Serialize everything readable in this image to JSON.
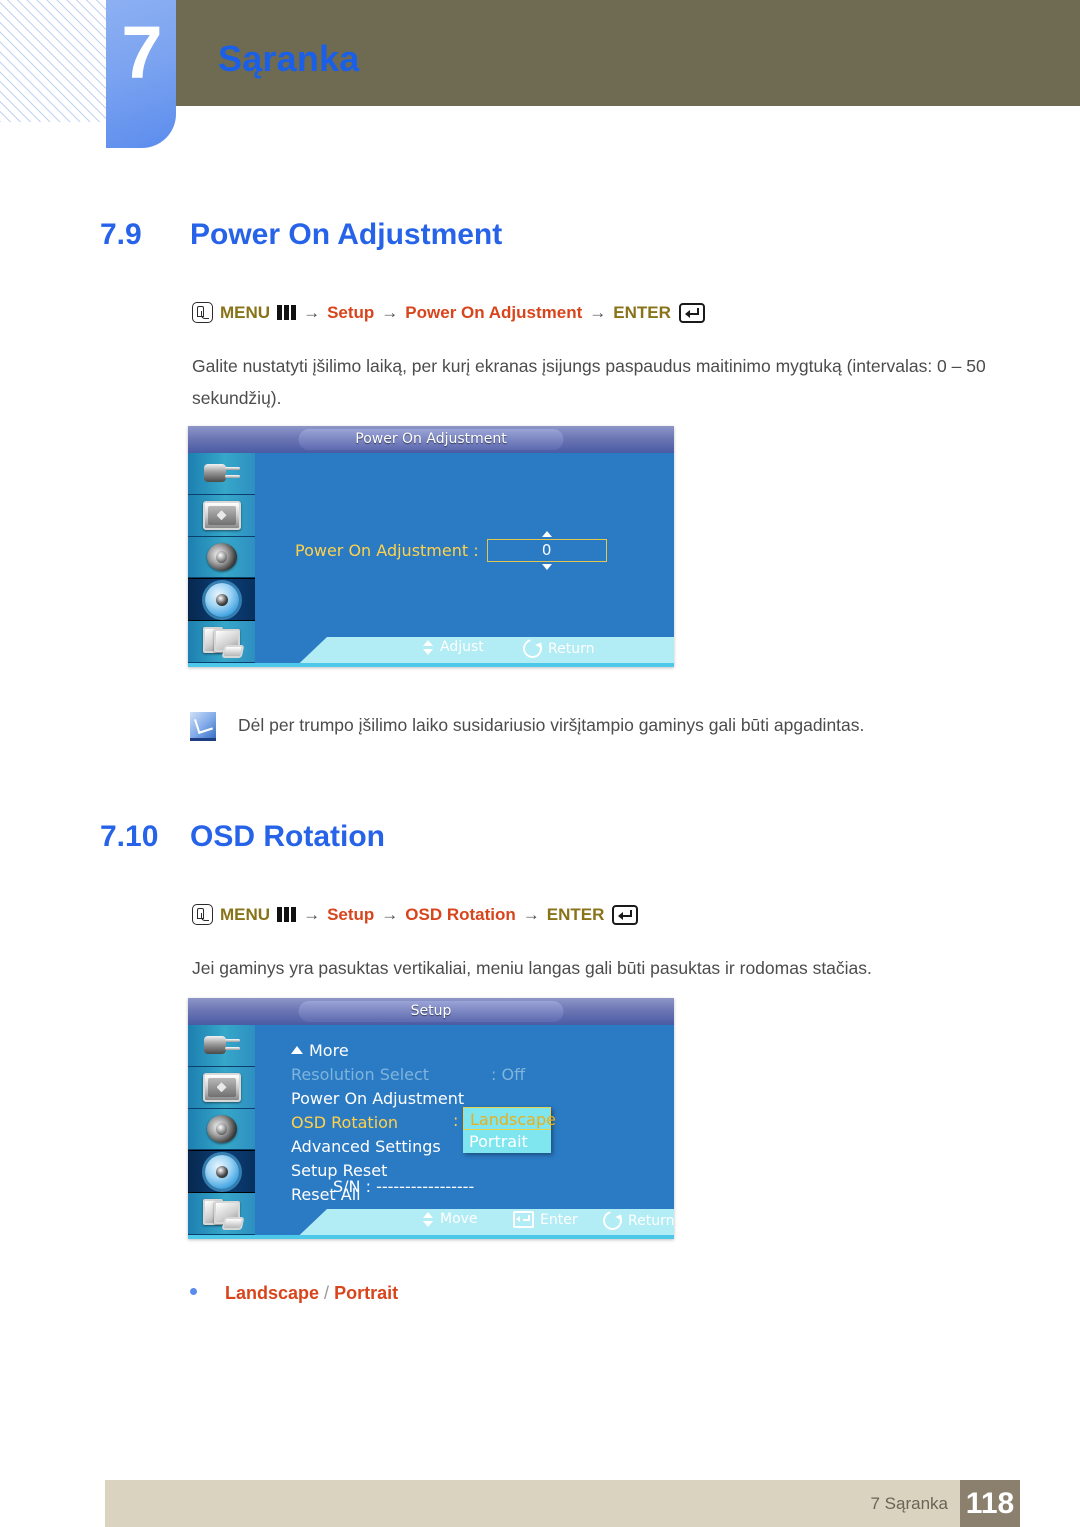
{
  "header": {
    "chapter_number": "7",
    "chapter_title": "Sąranka"
  },
  "sections": [
    {
      "number": "7.9",
      "title": "Power On Adjustment",
      "nav": {
        "menu_label": "MENU",
        "arrow": "→",
        "step1": "Setup",
        "step2": "Power On Adjustment",
        "enter_label": "ENTER"
      },
      "paragraph": "Galite nustatyti įšilimo laiką, per kurį ekranas įsijungs paspaudus maitinimo mygtuką (intervalas: 0 – 50 sekundžių).",
      "note": "Dėl per trumpo įšilimo laiko susidariusio viršįtampio gaminys gali būti apgadintas."
    },
    {
      "number": "7.10",
      "title": "OSD Rotation",
      "nav": {
        "menu_label": "MENU",
        "arrow": "→",
        "step1": "Setup",
        "step2": "OSD Rotation",
        "enter_label": "ENTER"
      },
      "paragraph": "Jei gaminys yra pasuktas vertikaliai, meniu langas gali būti pasuktas ir rodomas stačias.",
      "bullet": {
        "option1": "Landscape",
        "separator": " / ",
        "option2": "Portrait"
      }
    }
  ],
  "osd1": {
    "title": "Power On Adjustment",
    "sidebar_icons": [
      "plug-icon",
      "picture-icon",
      "speaker-icon",
      "gear-icon",
      "multi-display-icon"
    ],
    "active_sidebar_index": 3,
    "row_label": "Power On Adjustment :",
    "row_value": "0",
    "hints": [
      {
        "icon": "updown-icon",
        "label": "Adjust"
      },
      {
        "icon": "return-icon",
        "label": "Return"
      }
    ]
  },
  "osd2": {
    "title": "Setup",
    "sidebar_icons": [
      "plug-icon",
      "picture-icon",
      "speaker-icon",
      "gear-icon",
      "multi-display-icon"
    ],
    "active_sidebar_index": 3,
    "more_label": "More",
    "items": [
      {
        "label": "Resolution Select",
        "value": ": Off",
        "state": "dim"
      },
      {
        "label": "Power On Adjustment",
        "value": "",
        "state": "normal"
      },
      {
        "label": "OSD Rotation",
        "value": "",
        "state": "selected"
      },
      {
        "label": "Advanced Settings",
        "value": "",
        "state": "normal"
      },
      {
        "label": "Setup Reset",
        "value": "",
        "state": "normal"
      },
      {
        "label": "Reset All",
        "value": "",
        "state": "normal"
      }
    ],
    "dropdown": {
      "colon": ":",
      "selected": "Landscape",
      "other": "Portrait"
    },
    "serial": "S/N : -----------------",
    "hints": [
      {
        "icon": "updown-icon",
        "label": "Move"
      },
      {
        "icon": "enter-icon",
        "label": "Enter"
      },
      {
        "icon": "return-icon",
        "label": "Return"
      }
    ]
  },
  "footer": {
    "chapter": "7 Sąranka",
    "page": "118"
  },
  "colors": {
    "heading_blue": "#2663e8",
    "nav_gold": "#897318",
    "nav_red": "#d8451c",
    "olive": "#6e6b52",
    "tab_blue": "#5b8ced",
    "footer_beige": "#d9d3c0",
    "footer_page_box": "#8b7f6e",
    "osd_blue": "#2b7ac4",
    "osd_yellow": "#ffd24a",
    "osd_cyan": "#7fe6f0"
  }
}
